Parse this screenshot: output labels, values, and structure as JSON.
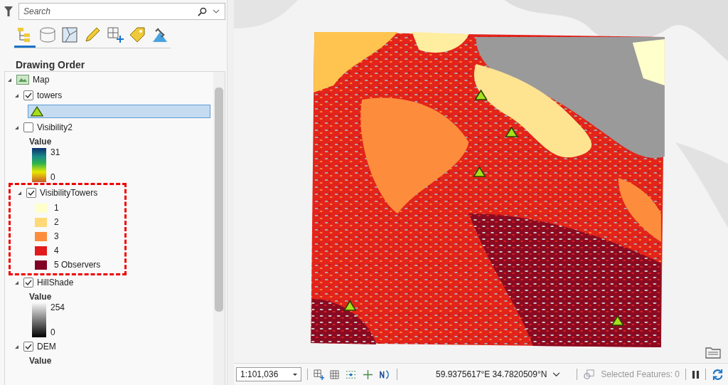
{
  "search": {
    "placeholder": "Search"
  },
  "tabs": [
    {
      "kind": "tree",
      "selected": true
    },
    {
      "kind": "db",
      "selected": false
    },
    {
      "kind": "poly",
      "selected": false
    },
    {
      "kind": "pencil",
      "selected": false
    },
    {
      "kind": "grid",
      "selected": false
    },
    {
      "kind": "tag",
      "selected": false
    },
    {
      "kind": "sat",
      "selected": false
    }
  ],
  "panel_title": "Drawing Order",
  "map": {
    "name": "Map",
    "expanded": true
  },
  "layers": [
    {
      "name": "towers",
      "checked": true,
      "expanded": true,
      "highlighted": false,
      "kind": "symbol",
      "selected": true
    },
    {
      "name": "Visibility2",
      "checked": false,
      "expanded": true,
      "highlighted": false,
      "kind": "spectrum",
      "heading": "Value",
      "high": "31",
      "low": "0"
    },
    {
      "name": "VisibilityTowers",
      "checked": true,
      "expanded": true,
      "highlighted": true,
      "kind": "classes",
      "classes": [
        {
          "label": "1",
          "color": "#ffffcc"
        },
        {
          "label": "2",
          "color": "#fed976"
        },
        {
          "label": "3",
          "color": "#fd8d3c"
        },
        {
          "label": "4",
          "color": "#e31a1c"
        },
        {
          "label": "5 Observers",
          "color": "#800026"
        }
      ]
    },
    {
      "name": "HillShade",
      "checked": true,
      "expanded": true,
      "highlighted": false,
      "kind": "grayscale",
      "heading": "Value",
      "high": "254",
      "low": "0"
    },
    {
      "name": "DEM",
      "checked": true,
      "expanded": true,
      "highlighted": false,
      "kind": "heading",
      "heading": "Value"
    }
  ],
  "status_bar": {
    "scale": "1:101,036",
    "coordinates": "59.9375617°E 34.7820509°N",
    "selected_features": "Selected Features: 0"
  }
}
